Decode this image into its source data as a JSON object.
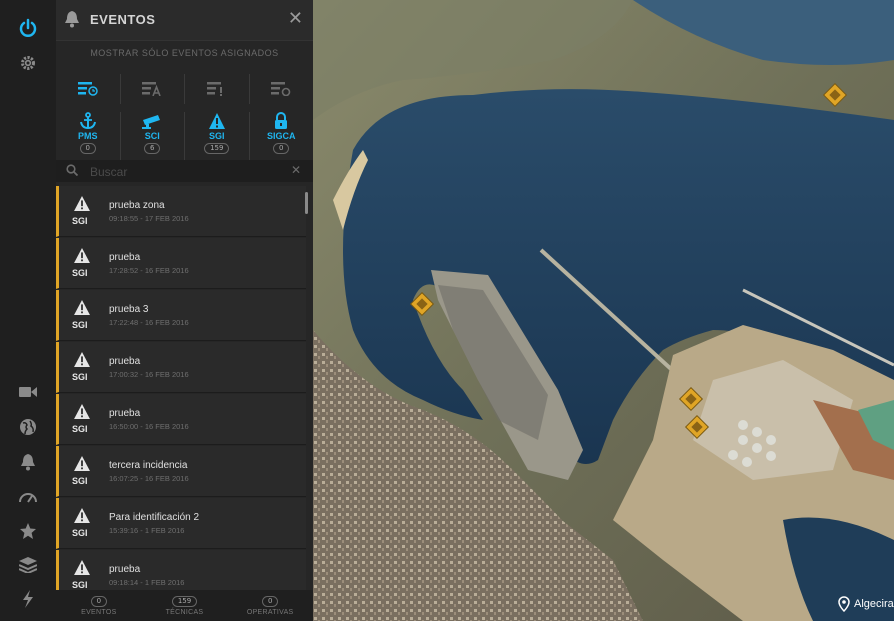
{
  "panel": {
    "title": "EVENTOS",
    "assigned_toggle": "MOSTRAR SÓLO EVENTOS ASIGNADOS",
    "search_placeholder": "Buscar"
  },
  "categories": [
    {
      "label": "PMS",
      "count": "0",
      "icon": "anchor-icon"
    },
    {
      "label": "SCI",
      "count": "6",
      "icon": "camera-icon"
    },
    {
      "label": "SGI",
      "count": "159",
      "icon": "warning-icon"
    },
    {
      "label": "SIGCA",
      "count": "0",
      "icon": "lock-icon"
    }
  ],
  "events": [
    {
      "category": "SGI",
      "name": "prueba zona",
      "time": "09:18:55 - 17 FEB 2016"
    },
    {
      "category": "SGI",
      "name": "prueba",
      "time": "17:28:52 - 16 FEB 2016"
    },
    {
      "category": "SGI",
      "name": "prueba 3",
      "time": "17:22:48 - 16 FEB 2016"
    },
    {
      "category": "SGI",
      "name": "prueba",
      "time": "17:00:32 - 16 FEB 2016"
    },
    {
      "category": "SGI",
      "name": "prueba",
      "time": "16:50:00 - 16 FEB 2016"
    },
    {
      "category": "SGI",
      "name": "tercera incidencia",
      "time": "16:07:25 - 16 FEB 2016"
    },
    {
      "category": "SGI",
      "name": "Para identificación 2",
      "time": "15:39:16 - 1 FEB 2016"
    },
    {
      "category": "SGI",
      "name": "prueba",
      "time": "09:18:14 - 1 FEB 2016"
    }
  ],
  "footer_tabs": [
    {
      "label": "EVENTOS",
      "count": "0"
    },
    {
      "label": "TÉCNICAS",
      "count": "159"
    },
    {
      "label": "OPERATIVAS",
      "count": "0"
    }
  ],
  "map": {
    "location_label": "Algecira"
  },
  "colors": {
    "accent_blue": "#1fb6f0",
    "event_bar": "#e0a526",
    "marker": "#e0a526",
    "sea": "#1e3e5e"
  }
}
